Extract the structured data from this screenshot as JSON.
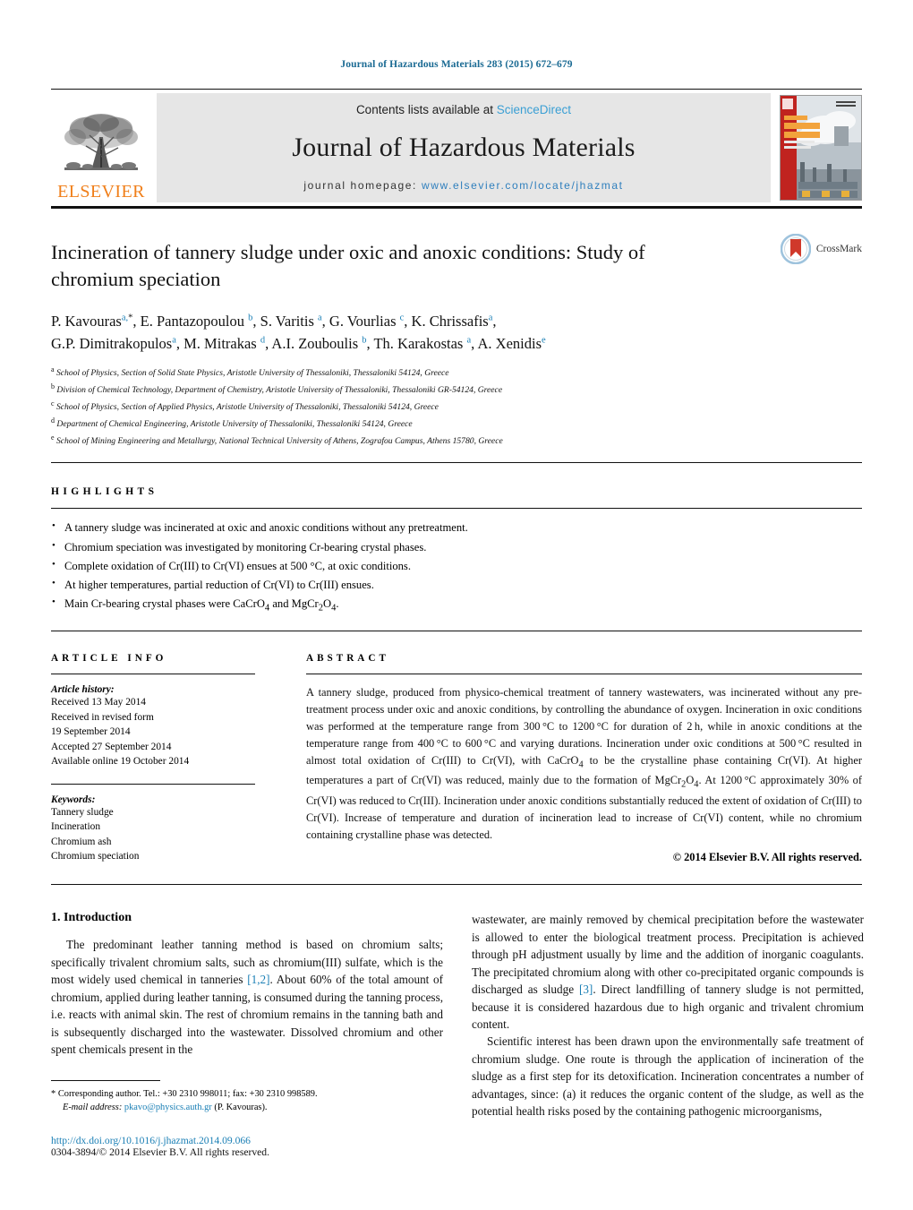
{
  "running_head": "Journal of Hazardous Materials 283 (2015) 672–679",
  "banner": {
    "publisher": "ELSEVIER",
    "contents_prefix": "Contents lists available at ",
    "contents_link": "ScienceDirect",
    "journal_name": "Journal of Hazardous Materials",
    "homepage_prefix": "journal homepage: ",
    "homepage_url": "www.elsevier.com/locate/jhazmat",
    "cover_alt": "Journal of Hazardous Materials cover",
    "link_color": "#3a9fd4"
  },
  "crossmark": {
    "label": "CrossMark"
  },
  "article": {
    "title": "Incineration of tannery sludge under oxic and anoxic conditions: Study of chromium speciation",
    "authors_line1_parts": [
      {
        "name": "P. Kavouras",
        "sup": "a,",
        "star": "*"
      },
      {
        "name": ", E. Pantazopoulou ",
        "sup": "b"
      },
      {
        "name": ", S. Varitis ",
        "sup": "a"
      },
      {
        "name": ", G. Vourlias ",
        "sup": "c"
      },
      {
        "name": ", K. Chrissafis",
        "sup": "a"
      },
      {
        "name": ",",
        "sup": ""
      }
    ],
    "authors_line2_parts": [
      {
        "name": "G.P. Dimitrakopulos",
        "sup": "a"
      },
      {
        "name": ", M. Mitrakas ",
        "sup": "d"
      },
      {
        "name": ", A.I. Zouboulis ",
        "sup": "b"
      },
      {
        "name": ", Th. Karakostas ",
        "sup": "a"
      },
      {
        "name": ", A. Xenidis",
        "sup": "e"
      }
    ],
    "affiliations": [
      {
        "mark": "a",
        "text": "School of Physics, Section of Solid State Physics, Aristotle University of Thessaloniki, Thessaloniki 54124, Greece"
      },
      {
        "mark": "b",
        "text": "Division of Chemical Technology, Department of Chemistry, Aristotle University of Thessaloniki, Thessaloniki GR-54124, Greece"
      },
      {
        "mark": "c",
        "text": "School of Physics, Section of Applied Physics, Aristotle University of Thessaloniki, Thessaloniki 54124, Greece"
      },
      {
        "mark": "d",
        "text": "Department of Chemical Engineering, Aristotle University of Thessaloniki, Thessaloniki 54124, Greece"
      },
      {
        "mark": "e",
        "text": "School of Mining Engineering and Metallurgy, National Technical University of Athens, Zografou Campus, Athens 15780, Greece"
      }
    ]
  },
  "highlights": {
    "label": "HIGHLIGHTS",
    "items": [
      "A tannery sludge was incinerated at oxic and anoxic conditions without any pretreatment.",
      "Chromium speciation was investigated by monitoring Cr-bearing crystal phases.",
      "Complete oxidation of Cr(III) to Cr(VI) ensues at 500 °C, at oxic conditions.",
      "At higher temperatures, partial reduction of Cr(VI) to Cr(III) ensues.",
      "Main Cr-bearing crystal phases were CaCrO4 and MgCr2O4."
    ]
  },
  "article_info": {
    "label": "ARTICLE INFO",
    "history_title": "Article history:",
    "history_lines": [
      "Received 13 May 2014",
      "Received in revised form",
      "19 September 2014",
      "Accepted 27 September 2014",
      "Available online 19 October 2014"
    ],
    "keywords_title": "Keywords:",
    "keywords": [
      "Tannery sludge",
      "Incineration",
      "Chromium ash",
      "Chromium speciation"
    ]
  },
  "abstract": {
    "label": "ABSTRACT",
    "text": "A tannery sludge, produced from physico-chemical treatment of tannery wastewaters, was incinerated without any pre-treatment process under oxic and anoxic conditions, by controlling the abundance of oxygen. Incineration in oxic conditions was performed at the temperature range from 300 °C to 1200 °C for duration of 2 h, while in anoxic conditions at the temperature range from 400 °C to 600 °C and varying durations. Incineration under oxic conditions at 500 °C resulted in almost total oxidation of Cr(III) to Cr(VI), with CaCrO4 to be the crystalline phase containing Cr(VI). At higher temperatures a part of Cr(VI) was reduced, mainly due to the formation of MgCr2O4. At 1200 °C approximately 30% of Cr(VI) was reduced to Cr(III). Incineration under anoxic conditions substantially reduced the extent of oxidation of Cr(III) to Cr(VI). Increase of temperature and duration of incineration lead to increase of Cr(VI) content, while no chromium containing crystalline phase was detected.",
    "copyright": "© 2014 Elsevier B.V. All rights reserved."
  },
  "introduction": {
    "heading": "1. Introduction",
    "left_para_1": "The predominant leather tanning method is based on chromium salts; specifically trivalent chromium salts, such as chromium(III) sulfate, which is the most widely used chemical in tanneries [1,2]. About 60% of the total amount of chromium, applied during leather tanning, is consumed during the tanning process, i.e. reacts with animal skin. The rest of chromium remains in the tanning bath and is subsequently discharged into the wastewater. Dissolved chromium and other spent chemicals present in the",
    "right_para_1": "wastewater, are mainly removed by chemical precipitation before the wastewater is allowed to enter the biological treatment process. Precipitation is achieved through pH adjustment usually by lime and the addition of inorganic coagulants. The precipitated chromium along with other co-precipitated organic compounds is discharged as sludge [3]. Direct landfilling of tannery sludge is not permitted, because it is considered hazardous due to high organic and trivalent chromium content.",
    "right_para_2": "Scientific interest has been drawn upon the environmentally safe treatment of chromium sludge. One route is through the application of incineration of the sludge as a first step for its detoxification. Incineration concentrates a number of advantages, since: (a) it reduces the organic content of the sludge, as well as the potential health risks posed by the containing pathogenic microorganisms,"
  },
  "footer": {
    "corresponding_star": "*",
    "corresponding_text": "Corresponding author. Tel.: +30 2310 998011; fax: +30 2310 998589.",
    "email_label": "E-mail address:",
    "email": "pkavo@physics.auth.gr",
    "email_owner": "(P. Kavouras).",
    "doi": "http://dx.doi.org/10.1016/j.jhazmat.2014.09.066",
    "issn": "0304-3894/© 2014 Elsevier B.V. All rights reserved."
  }
}
